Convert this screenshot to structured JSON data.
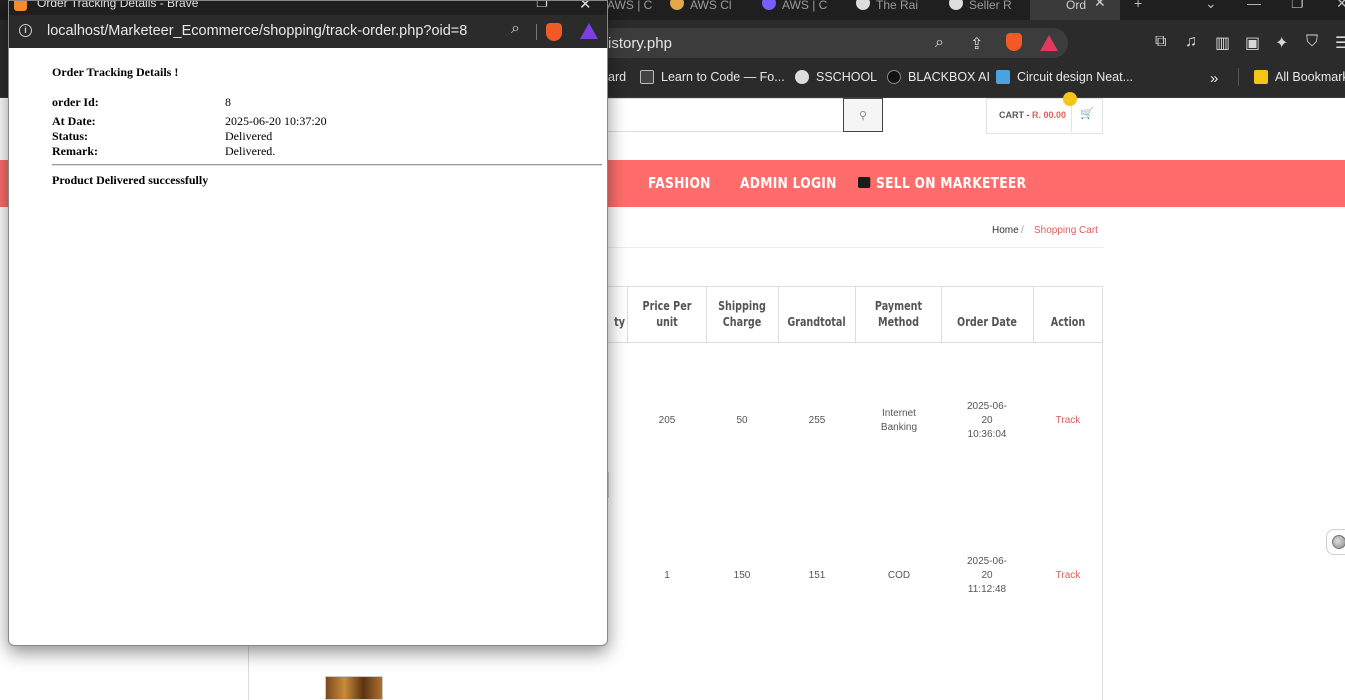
{
  "background_browser": {
    "tabs": [
      {
        "label": "AWS | C",
        "color": "#aaaaaa"
      },
      {
        "label": "AWS Cl",
        "color": "#e4a74b"
      },
      {
        "label": "AWS | C",
        "color": "#7b5cff"
      },
      {
        "label": "The Rai",
        "color": "#dddddd"
      },
      {
        "label": "Seller R",
        "color": "#dddddd"
      },
      {
        "label": "Ord",
        "color": "#cfcfcf"
      }
    ],
    "url_fragment": "istory.php",
    "bookmarks": [
      {
        "label": "ard",
        "color": "#2b2b2b"
      },
      {
        "label": "Learn to Code — Fo...",
        "color": "#444444"
      },
      {
        "label": "SSCHOOL",
        "color": "#dddddd"
      },
      {
        "label": "BLACKBOX AI",
        "color": "#111111"
      },
      {
        "label": "Circuit design Neat...",
        "color": "#4aa3df"
      },
      {
        "label": "All Bookmarks",
        "color": "#f5c518"
      }
    ],
    "more_bookmarks_glyph": "»"
  },
  "site": {
    "cart": {
      "label": "CART -",
      "price": "R. 00.00"
    },
    "nav": {
      "fashion": "FASHION",
      "admin_login": "ADMIN LOGIN",
      "sell": "SELL ON MARKETEER"
    },
    "breadcrumb": {
      "home": "Home",
      "current": "Shopping Cart"
    },
    "table": {
      "headers": {
        "qty": "ty",
        "price_per_unit": "Price Per unit",
        "shipping_charge": "Shipping Charge",
        "grandtotal": "Grandtotal",
        "payment_method": "Payment Method",
        "order_date": "Order Date",
        "action": "Action"
      },
      "rows": [
        {
          "price": "205",
          "shipping": "50",
          "grandtotal": "255",
          "payment": "Internet Banking",
          "date": "2025-06-20 10:36:04",
          "action": "Track"
        },
        {
          "price": "1",
          "shipping": "150",
          "grandtotal": "151",
          "payment": "COD",
          "date": "2025-06-20 11:12:48",
          "action": "Track"
        }
      ]
    }
  },
  "popup": {
    "window_title": "Order Tracking Details - Brave",
    "url": "localhost/Marketeer_Ecommerce/shopping/track-order.php?oid=8",
    "heading": "Order Tracking Details !",
    "fields": {
      "order_id_label": "order Id:",
      "order_id": "8",
      "date_label": "At Date:",
      "date": "2025-06-20 10:37:20",
      "status_label": "Status:",
      "status": "Delivered",
      "remark_label": "Remark:",
      "remark": "Delivered."
    },
    "message": "Product Delivered successfully"
  },
  "colors": {
    "nav_bg": "#fe6d6b",
    "accent_link": "#e05c5c",
    "chrome_dark": "#2b2b2b"
  }
}
